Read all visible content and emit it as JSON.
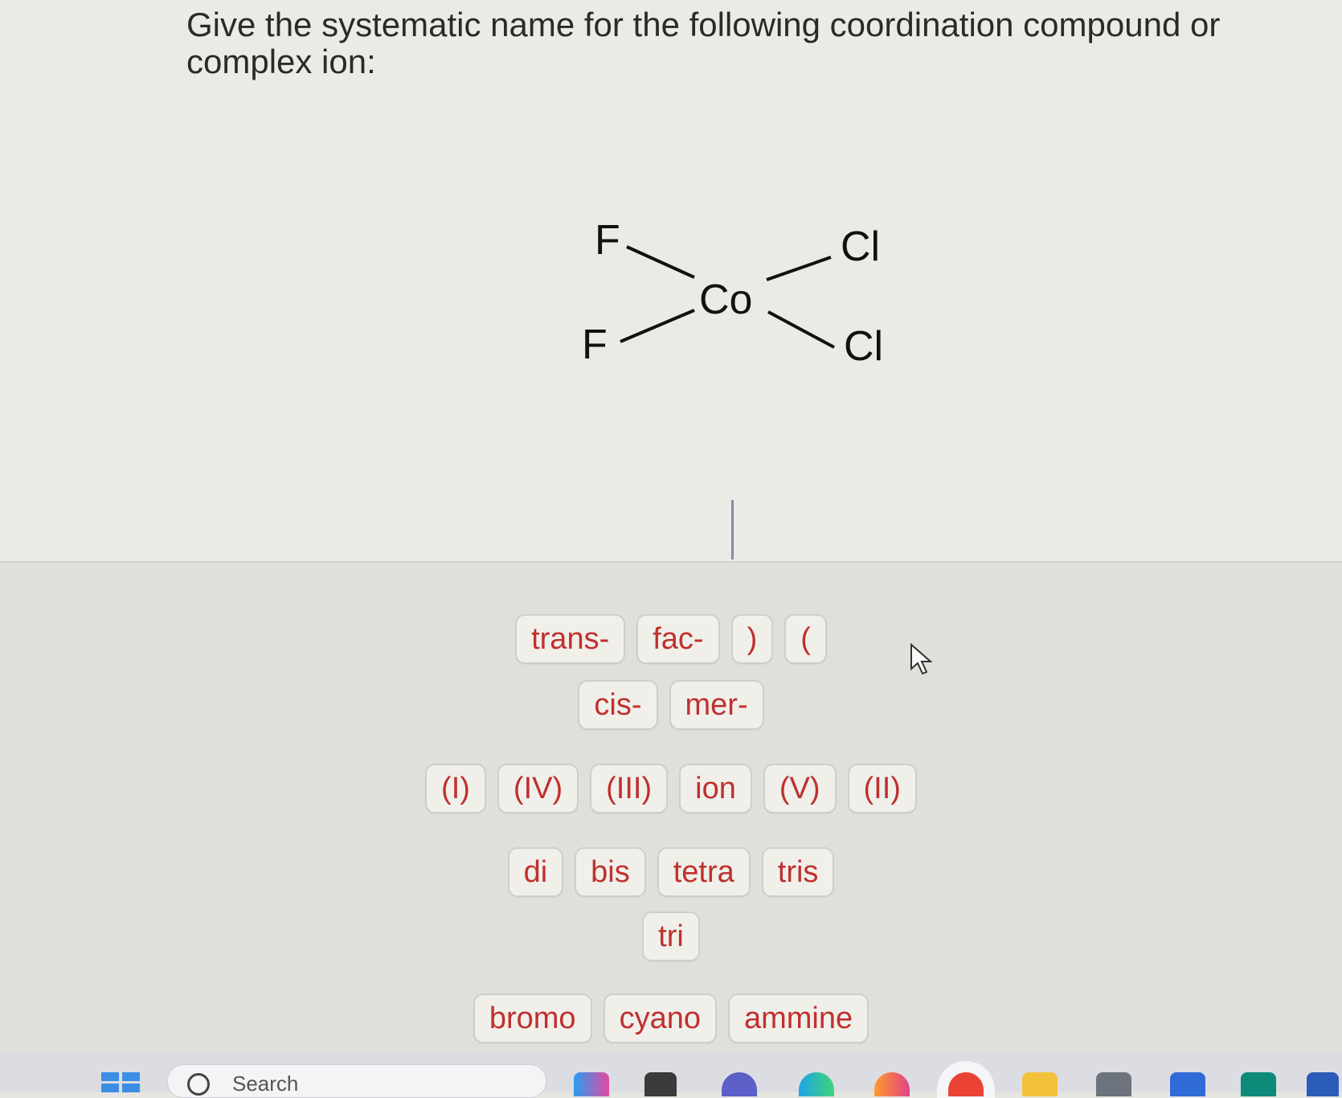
{
  "question": {
    "prompt": "Give the systematic name for the following coordination compound or complex ion:"
  },
  "molecule": {
    "center": "Co",
    "ligands": [
      "F",
      "F",
      "Cl",
      "Cl"
    ]
  },
  "answer_tiles": {
    "row1": [
      "trans-",
      "fac-",
      ")",
      "("
    ],
    "row2": [
      "cis-",
      "mer-"
    ],
    "row3": [
      "(I)",
      "(IV)",
      "(III)",
      "ion",
      "(V)",
      "(II)"
    ],
    "row4": [
      "di",
      "bis",
      "tetra",
      "tris"
    ],
    "row5": [
      "tri"
    ],
    "row6": [
      "bromo",
      "cyano",
      "ammine"
    ]
  },
  "taskbar": {
    "search_label": "Search"
  },
  "colors": {
    "tile_text": "#c0302e",
    "tile_border": "#cfcec9",
    "windows_blue": "#3c8ee3"
  }
}
